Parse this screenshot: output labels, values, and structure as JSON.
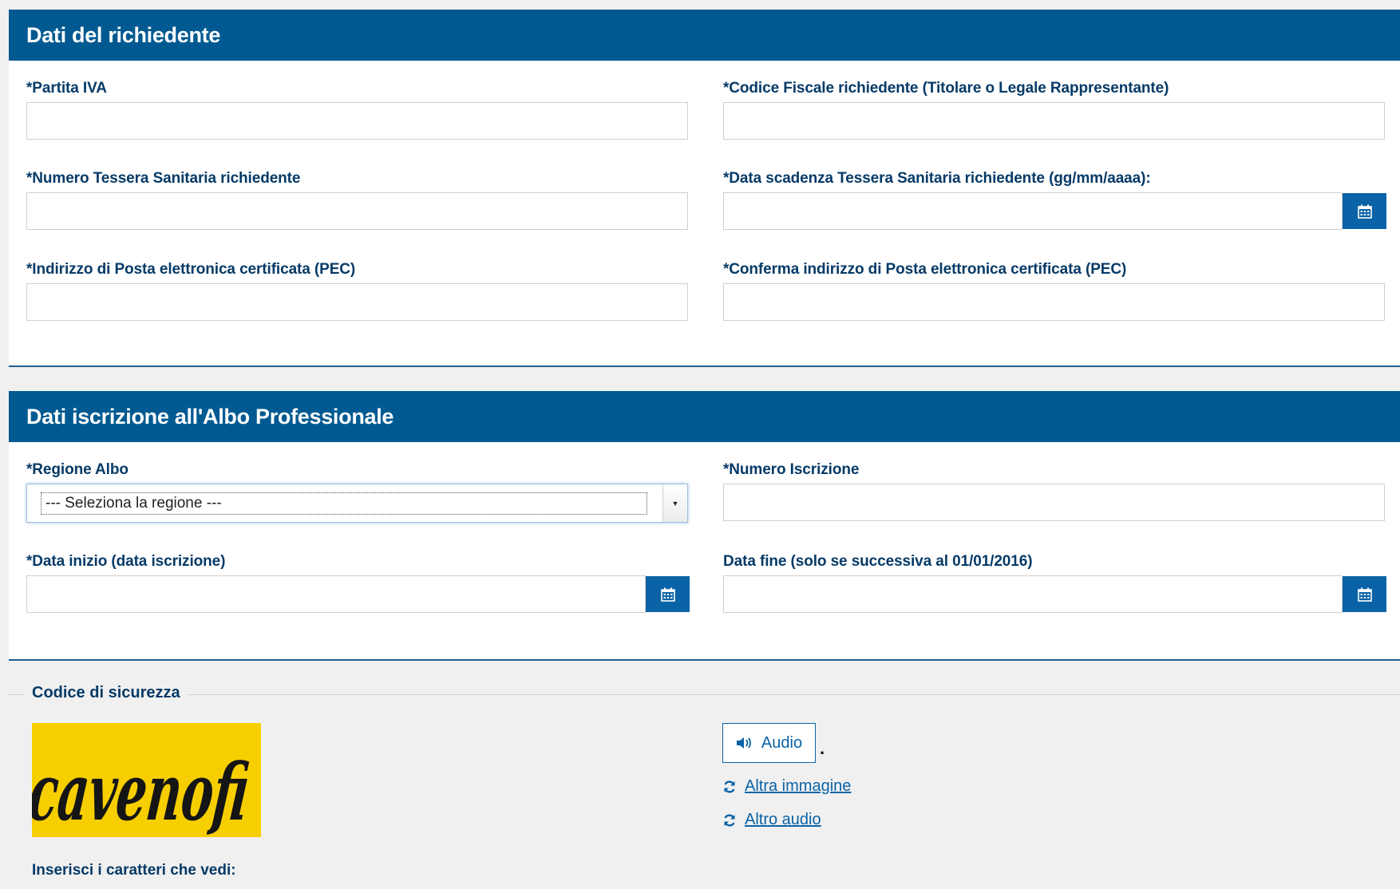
{
  "sections": {
    "richiedente": {
      "title": "Dati del richiedente",
      "fields": {
        "partita_iva": {
          "label": "*Partita IVA",
          "value": ""
        },
        "codice_fiscale": {
          "label": "*Codice Fiscale richiedente (Titolare o Legale Rappresentante)",
          "value": ""
        },
        "numero_tessera": {
          "label": "*Numero Tessera Sanitaria richiedente",
          "value": ""
        },
        "data_scadenza": {
          "label": "*Data scadenza Tessera Sanitaria richiedente (gg/mm/aaaa):",
          "value": ""
        },
        "pec": {
          "label": "*Indirizzo di Posta elettronica certificata (PEC)",
          "value": ""
        },
        "conferma_pec": {
          "label": "*Conferma indirizzo di Posta elettronica certificata (PEC)",
          "value": ""
        }
      }
    },
    "albo": {
      "title": "Dati iscrizione all'Albo Professionale",
      "fields": {
        "regione": {
          "label": "*Regione Albo",
          "selected": "--- Seleziona la regione ---"
        },
        "numero_iscrizione": {
          "label": "*Numero Iscrizione",
          "value": ""
        },
        "data_inizio": {
          "label": "*Data inizio (data iscrizione)",
          "value": ""
        },
        "data_fine": {
          "label": "Data fine (solo se successiva al 01/01/2016)",
          "value": ""
        }
      }
    }
  },
  "captcha": {
    "legend": "Codice di sicurezza",
    "image_text": "cavenofi",
    "audio_label": "Audio",
    "dot": ".",
    "altra_immagine": "Altra immagine",
    "altro_audio": "Altro audio",
    "insert_label": "Inserisci i caratteri che vedi:"
  },
  "icons": {
    "calendar": "calendar-icon",
    "speaker": "speaker-icon",
    "refresh": "refresh-icon"
  },
  "colors": {
    "header_bg": "#005a91",
    "accent": "#0a63a7",
    "label": "#053a67",
    "captcha_bg": "#f7cf00"
  }
}
